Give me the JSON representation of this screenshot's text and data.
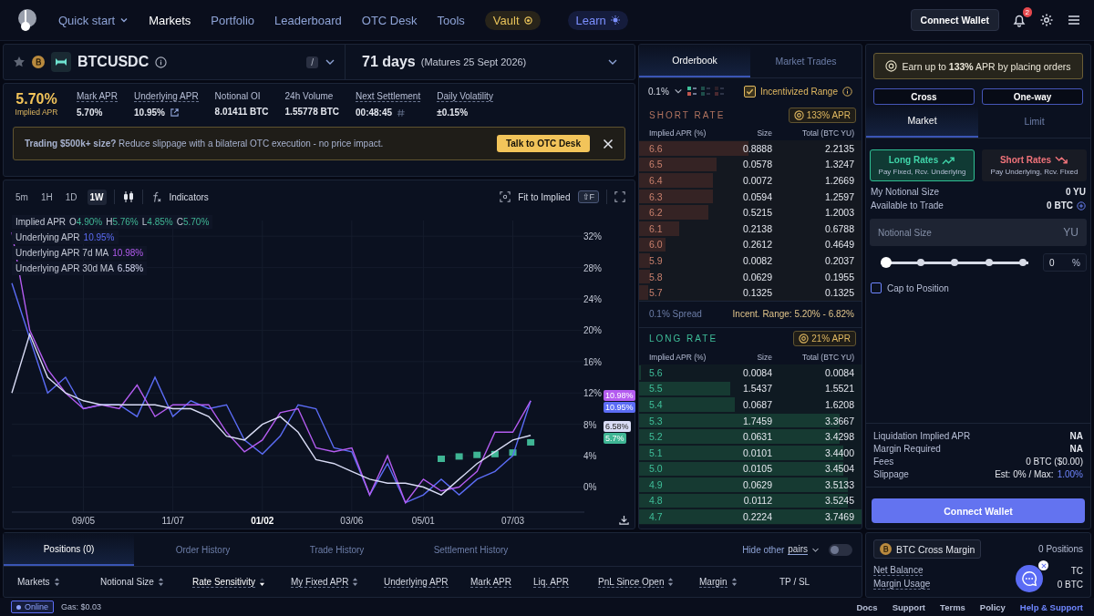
{
  "header": {
    "nav": [
      {
        "label": "Quick start",
        "kind": "dropdown",
        "selected": false
      },
      {
        "label": "Markets",
        "kind": "link",
        "selected": true
      },
      {
        "label": "Portfolio",
        "kind": "link",
        "selected": false
      },
      {
        "label": "Leaderboard",
        "kind": "link",
        "selected": false
      },
      {
        "label": "OTC Desk",
        "kind": "link",
        "selected": false
      },
      {
        "label": "Tools",
        "kind": "link",
        "selected": false
      },
      {
        "label": "Vault",
        "kind": "vault",
        "selected": false
      },
      {
        "label": "Learn",
        "kind": "learn",
        "selected": false
      }
    ],
    "connect_button": "Connect Wallet",
    "notification_count": "2"
  },
  "market": {
    "pair": "BTCUSDC",
    "shortcut": "/",
    "maturity_days": "71 days",
    "maturity_date": "(Matures 25 Sept 2026)"
  },
  "stats": {
    "implied_apr": "5.70%",
    "implied_label": "Implied APR",
    "items": [
      {
        "label": "Mark APR",
        "value": "5.70%",
        "underlined": true,
        "kind": "plain"
      },
      {
        "label": "Underlying APR",
        "value": "10.95%",
        "underlined": true,
        "kind": "link"
      },
      {
        "label": "Notional OI",
        "value": "8.01411 BTC",
        "underlined": false,
        "kind": "plain"
      },
      {
        "label": "24h Volume",
        "value": "1.55778 BTC",
        "underlined": false,
        "kind": "plain"
      },
      {
        "label": "Next Settlement",
        "value": "00:48:45",
        "underlined": true,
        "kind": "hash"
      },
      {
        "label": "Daily Volatility",
        "value": "±0.15%",
        "underlined": true,
        "kind": "plain"
      }
    ]
  },
  "banner": {
    "text": "**Trading $500k+ size?** Reduce slippage with a bilateral OTC execution - no price impact.",
    "button": "Talk to OTC Desk"
  },
  "chart": {
    "intervals": [
      {
        "label": "5m",
        "selected": false
      },
      {
        "label": "1H",
        "selected": false
      },
      {
        "label": "1D",
        "selected": false
      },
      {
        "label": "1W",
        "selected": true
      }
    ],
    "indicators": "Indicators",
    "fit": "Fit to Implied",
    "fit_shortcut": "⇧F",
    "legend": [
      {
        "ohlc": [
          {
            "key": "O",
            "value": "4.90%"
          },
          {
            "key": "H",
            "value": "5.76%"
          },
          {
            "key": "L",
            "value": "4.85%"
          },
          {
            "key": "C",
            "value": "5.70%"
          }
        ]
      },
      {
        "value": "10.95%"
      },
      {
        "value": "10.98%"
      },
      {
        "value": "6.58%"
      }
    ],
    "price_tags": [
      {
        "text": "10.98%",
        "color": "#b45cf0"
      },
      {
        "text": "10.95%",
        "color": "#5b6cf5"
      },
      {
        "text": "6.58%",
        "color": "#d9dcf5"
      },
      {
        "text": "5.7%",
        "color": "#3fb594"
      }
    ],
    "chart_data": {
      "type": "line",
      "categories": [
        null,
        null,
        null,
        null,
        "09/05",
        null,
        null,
        null,
        null,
        "11/07",
        null,
        null,
        null,
        null,
        "01/02",
        null,
        null,
        null,
        null,
        "03/06",
        null,
        null,
        null,
        "05/01",
        null,
        null,
        null,
        null,
        "07/03",
        null
      ],
      "ylim": [
        -3.2,
        34
      ],
      "grid": true,
      "yticks": [
        {
          "value": 0,
          "label": "0%"
        },
        {
          "value": 4,
          "label": "4%"
        },
        {
          "value": 8,
          "label": "8%"
        },
        {
          "value": 12,
          "label": "12%"
        },
        {
          "value": 16,
          "label": "16%"
        },
        {
          "value": 20,
          "label": "20%"
        },
        {
          "value": 24,
          "label": "24%"
        },
        {
          "value": 28,
          "label": "28%"
        },
        {
          "value": 32,
          "label": "32%"
        }
      ],
      "series": [
        {
          "name": "Implied APR",
          "type": "scatter",
          "color": "#3fb594",
          "values": [
            null,
            null,
            null,
            null,
            null,
            null,
            null,
            null,
            null,
            null,
            null,
            null,
            null,
            null,
            null,
            null,
            null,
            null,
            null,
            null,
            null,
            null,
            null,
            null,
            3.6,
            3.9,
            4.1,
            4.2,
            4.4,
            5.7
          ]
        },
        {
          "name": "Underlying APR",
          "type": "line",
          "color": "#5b6cf5",
          "values": [
            26,
            19,
            12,
            14,
            10,
            10.5,
            10.5,
            9,
            14,
            9,
            11,
            10,
            10.5,
            6,
            4.2,
            6.5,
            10.5,
            10,
            5,
            4.5,
            -1,
            3,
            -2,
            -1,
            1,
            -1,
            1,
            2,
            4,
            11
          ]
        },
        {
          "name": "Underlying APR 7d MA",
          "type": "line",
          "color": "#b45cf0",
          "values": [
            32.5,
            20,
            15,
            12,
            10,
            10.5,
            10,
            13,
            9,
            10.5,
            10.5,
            10.5,
            7,
            4.5,
            6,
            9.5,
            10,
            5,
            4.5,
            5,
            -1,
            4,
            -2,
            1,
            -0.5,
            0,
            2,
            7,
            7,
            11
          ]
        },
        {
          "name": "Underlying APR 30d MA",
          "type": "line",
          "color": "#d9dcf5",
          "values": [
            12,
            19.5,
            14,
            12,
            11,
            10.5,
            10.5,
            10.5,
            10.5,
            10,
            10,
            9,
            6.5,
            6,
            8,
            9,
            7,
            3.5,
            3,
            2,
            1,
            0.5,
            0.5,
            0,
            -1,
            1,
            3,
            4.5,
            6,
            6.6
          ]
        }
      ]
    }
  },
  "orderbook": {
    "tabs": [
      {
        "label": "Orderbook",
        "selected": true
      },
      {
        "label": "Market Trades",
        "selected": false
      }
    ],
    "tick": "0.1%",
    "layouts": [
      {
        "selected": true
      },
      {
        "selected": false
      },
      {
        "selected": false
      }
    ],
    "incentivized": {
      "label": "Incentivized Range",
      "checked": true
    },
    "short": {
      "title": "SHORT RATE",
      "badge": "133% APR",
      "columns": [
        "Implied APR (%)",
        "Size",
        "Total (BTC YU)"
      ],
      "rows": [
        {
          "rate": "6.6",
          "size": "0.8888",
          "total": "2.2135",
          "level": 0.49
        },
        {
          "rate": "6.5",
          "size": "0.0578",
          "total": "1.3247",
          "level": 0.35
        },
        {
          "rate": "6.4",
          "size": "0.0072",
          "total": "1.2669",
          "level": 0.33
        },
        {
          "rate": "6.3",
          "size": "0.0594",
          "total": "1.2597",
          "level": 0.33
        },
        {
          "rate": "6.2",
          "size": "0.5215",
          "total": "1.2003",
          "level": 0.31
        },
        {
          "rate": "6.1",
          "size": "0.2138",
          "total": "0.6788",
          "level": 0.18
        },
        {
          "rate": "6.0",
          "size": "0.2612",
          "total": "0.4649",
          "level": 0.12
        },
        {
          "rate": "5.9",
          "size": "0.0082",
          "total": "0.2037",
          "level": 0.05
        },
        {
          "rate": "5.8",
          "size": "0.0629",
          "total": "0.1955",
          "level": 0.05
        },
        {
          "rate": "5.7",
          "size": "0.1325",
          "total": "0.1325",
          "level": 0.04
        }
      ]
    },
    "spread": "0.1% Spread",
    "incent_range": "Incent. Range: 5.20% - 6.82%",
    "long": {
      "title": "LONG RATE",
      "badge": "21% APR",
      "columns": [
        "Implied APR (%)",
        "Size",
        "Total (BTC YU)"
      ],
      "rows": [
        {
          "rate": "5.6",
          "size": "0.0084",
          "total": "0.0084",
          "level": 0.01
        },
        {
          "rate": "5.5",
          "size": "1.5437",
          "total": "1.5521",
          "level": 0.41
        },
        {
          "rate": "5.4",
          "size": "0.0687",
          "total": "1.6208",
          "level": 0.43
        },
        {
          "rate": "5.3",
          "size": "1.7459",
          "total": "3.3667",
          "level": 0.9
        },
        {
          "rate": "5.2",
          "size": "0.0631",
          "total": "3.4298",
          "level": 0.9
        },
        {
          "rate": "5.1",
          "size": "0.0101",
          "total": "3.4400",
          "level": 0.92
        },
        {
          "rate": "5.0",
          "size": "0.0105",
          "total": "3.4504",
          "level": 0.92
        },
        {
          "rate": "4.9",
          "size": "0.0629",
          "total": "3.5133",
          "level": 0.94
        },
        {
          "rate": "4.8",
          "size": "0.0112",
          "total": "3.5245",
          "level": 0.94
        },
        {
          "rate": "4.7",
          "size": "0.2224",
          "total": "3.7469",
          "level": 1.0
        }
      ]
    }
  },
  "trade": {
    "promo": "Earn up to **133%** APR by placing orders",
    "modes": [
      "Cross",
      "One-way"
    ],
    "tabs": [
      {
        "label": "Market",
        "selected": true
      },
      {
        "label": "Limit",
        "selected": false
      }
    ],
    "sides": [
      {
        "label": "Long Rates",
        "sub": "Pay Fixed, Rcv. Underlying",
        "kind": "long",
        "selected": true
      },
      {
        "label": "Short Rates",
        "sub": "Pay Underlying, Rcv. Fixed",
        "kind": "short",
        "selected": false
      }
    ],
    "info": [
      {
        "label": "My Notional Size",
        "value": "0 YU",
        "kind": "plain"
      },
      {
        "label": "Available to Trade",
        "value": "0 BTC",
        "kind": "deposit"
      }
    ],
    "size_field": {
      "placeholder": "Notional Size",
      "unit": "YU"
    },
    "slider": {
      "level": 0
    },
    "percent": {
      "value": "0",
      "unit": "%"
    },
    "cap": {
      "label": "Cap to Position",
      "checked": false
    },
    "summary": [
      {
        "label": "Liquidation Implied APR",
        "value": "NA",
        "kind": "bold"
      },
      {
        "label": "Margin Required",
        "value": "NA",
        "kind": "bold"
      },
      {
        "label": "Fees",
        "value": "0 BTC ($0.00)",
        "kind": "plain"
      },
      {
        "label": "Slippage",
        "value": "Est: 0% / Max:",
        "highlight": "1.00%",
        "kind": "split"
      }
    ],
    "submit": "Connect Wallet"
  },
  "margin": {
    "chip": "BTC Cross Margin",
    "positions": "0 Positions",
    "rows": [
      {
        "label": "Net Balance",
        "value": "TC"
      },
      {
        "label": "Margin Usage",
        "value": "0 BTC"
      }
    ]
  },
  "positions": {
    "tabs": [
      {
        "label": "Positions (0)",
        "selected": true
      },
      {
        "label": "Order History",
        "selected": false
      },
      {
        "label": "Trade History",
        "selected": false
      },
      {
        "label": "Settlement History",
        "selected": false
      }
    ],
    "hide_label": "Hide other",
    "hide_pairs": "pairs",
    "hide_on": false,
    "columns": [
      {
        "label": "Markets",
        "sortable": true,
        "sorted": false,
        "underlined": false
      },
      {
        "label": "Notional Size",
        "sortable": true,
        "sorted": false,
        "underlined": false
      },
      {
        "label": "Rate Sensitivity",
        "sortable": true,
        "sorted": true,
        "underlined": true
      },
      {
        "label": "My Fixed APR",
        "sortable": true,
        "sorted": false,
        "underlined": true
      },
      {
        "label": "Underlying APR",
        "sortable": false,
        "sorted": false,
        "underlined": true
      },
      {
        "label": "Mark APR",
        "sortable": false,
        "sorted": false,
        "underlined": true
      },
      {
        "label": "Liq. APR",
        "sortable": false,
        "sorted": false,
        "underlined": true
      },
      {
        "label": "PnL Since Open",
        "sortable": true,
        "sorted": false,
        "underlined": true
      },
      {
        "label": "Margin",
        "sortable": true,
        "sorted": false,
        "underlined": true
      },
      {
        "label": "TP / SL",
        "sortable": false,
        "sorted": false,
        "underlined": false
      }
    ]
  },
  "status": {
    "online": "Online",
    "gas": "Gas: $0.03",
    "links": [
      {
        "label": "Docs",
        "kind": "plain"
      },
      {
        "label": "Support",
        "kind": "plain"
      },
      {
        "label": "Terms",
        "kind": "plain"
      },
      {
        "label": "Policy",
        "kind": "plain"
      },
      {
        "label": "Help & Support",
        "kind": "accent"
      }
    ]
  }
}
